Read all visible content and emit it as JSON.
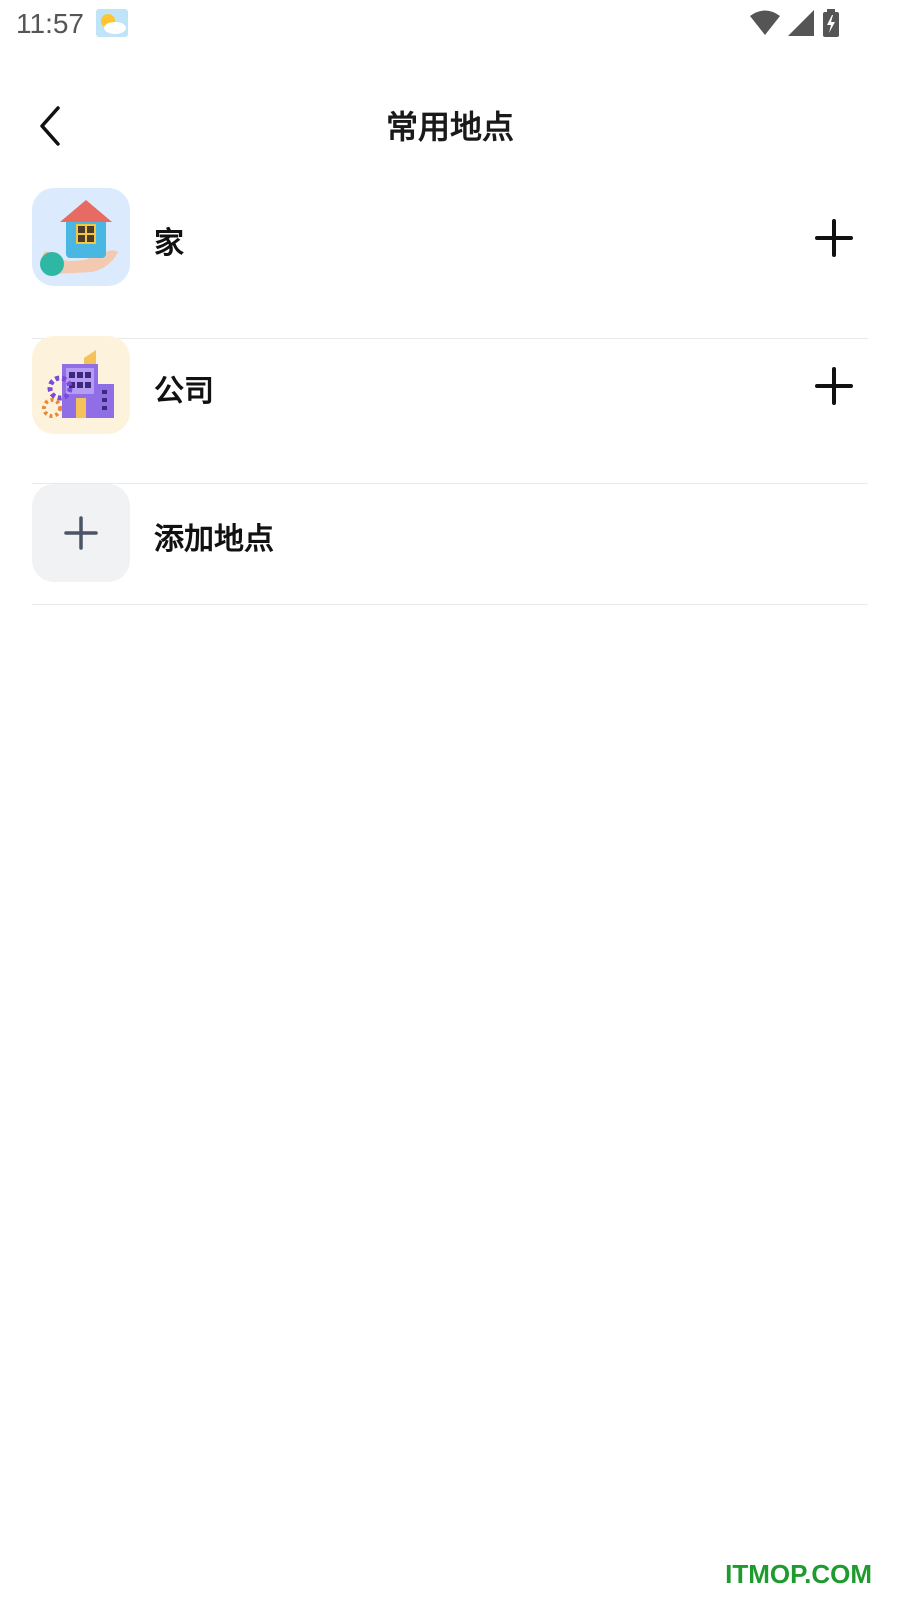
{
  "status_bar": {
    "time": "11:57",
    "weather_icon": "partly-sunny-icon",
    "signal_icons": [
      "wifi-icon",
      "cell-signal-icon",
      "battery-charging-icon"
    ]
  },
  "header": {
    "back_icon": "chevron-left-icon",
    "title": "常用地点"
  },
  "places": [
    {
      "label": "家",
      "icon": "house-in-hand-icon",
      "action_icon": "plus-icon"
    },
    {
      "label": "公司",
      "icon": "office-building-icon",
      "action_icon": "plus-icon"
    }
  ],
  "add_place": {
    "label": "添加地点",
    "icon": "plus-icon"
  },
  "watermark": "ITMOP.COM",
  "colors": {
    "home_bg": "#dbeafc",
    "company_bg": "#fdf3dd",
    "add_bg": "#f1f2f4",
    "divider": "#e9e9e9",
    "watermark": "#1e9b2e"
  }
}
